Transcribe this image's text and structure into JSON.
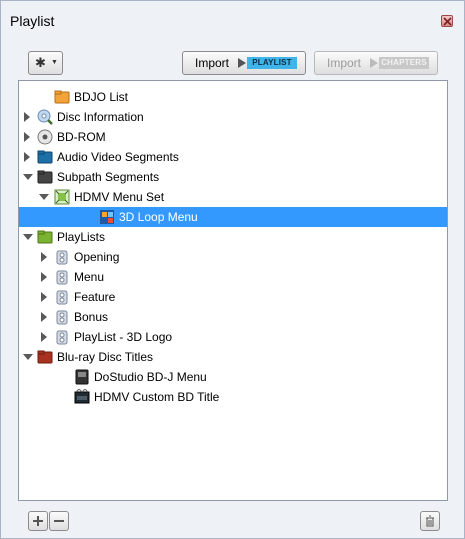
{
  "panel": {
    "title": "Playlist"
  },
  "toolbar": {
    "settings_icon": "gear-icon",
    "import_playlist": {
      "label": "Import",
      "tag": "PLAYLIST"
    },
    "import_chapters": {
      "label": "Import",
      "tag": "CHAPTERS"
    }
  },
  "tree": {
    "items": [
      {
        "label": "BDJO List",
        "icon": "orange-folder"
      },
      {
        "label": "Disc Information",
        "icon": "magnifier-disc"
      },
      {
        "label": "BD-ROM",
        "icon": "disc"
      },
      {
        "label": "Audio Video Segments",
        "icon": "blue-folder"
      },
      {
        "label": "Subpath Segments",
        "icon": "dark-folder"
      },
      {
        "label": "HDMV Menu Set",
        "icon": "menu-set"
      },
      {
        "label": "3D Loop Menu",
        "icon": "loop-menu"
      },
      {
        "label": "PlayLists",
        "icon": "green-folder"
      },
      {
        "label": "Opening",
        "icon": "film-reel"
      },
      {
        "label": "Menu",
        "icon": "film-reel"
      },
      {
        "label": "Feature",
        "icon": "film-reel"
      },
      {
        "label": "Bonus",
        "icon": "film-reel"
      },
      {
        "label": "PlayList - 3D Logo",
        "icon": "film-reel"
      },
      {
        "label": "Blu-ray Disc Titles",
        "icon": "red-folder"
      },
      {
        "label": "DoStudio BD-J Menu",
        "icon": "bdj-title"
      },
      {
        "label": "HDMV Custom BD Title",
        "icon": "hdmv-title"
      }
    ]
  },
  "colors": {
    "selection": "#3399ff",
    "import_tag": "#3fb4e8"
  },
  "footer": {
    "add_icon": "plus-icon",
    "remove_icon": "minus-icon",
    "delete_icon": "trash-icon"
  }
}
